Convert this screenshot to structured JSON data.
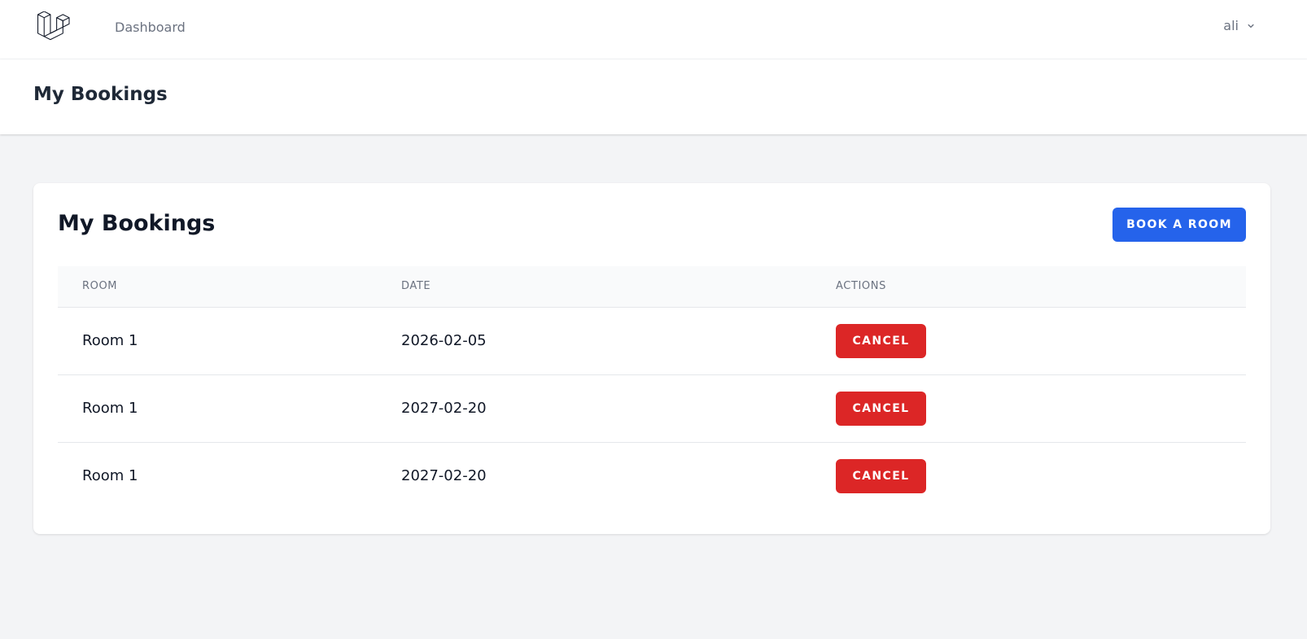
{
  "nav": {
    "logo_icon": "laravel-logo",
    "dashboard_label": "Dashboard",
    "user_name": "ali",
    "user_menu_icon": "chevron-down-icon"
  },
  "header": {
    "title": "My Bookings"
  },
  "card": {
    "title": "My Bookings",
    "book_button_label": "BOOK A ROOM",
    "accent_color": "#2563eb",
    "danger_color": "#dc2626"
  },
  "table": {
    "columns": [
      "ROOM",
      "DATE",
      "ACTIONS"
    ],
    "rows": [
      {
        "room": "Room 1",
        "date": "2026-02-05",
        "action": "CANCEL"
      },
      {
        "room": "Room 1",
        "date": "2027-02-20",
        "action": "CANCEL"
      },
      {
        "room": "Room 1",
        "date": "2027-02-20",
        "action": "CANCEL"
      }
    ]
  }
}
